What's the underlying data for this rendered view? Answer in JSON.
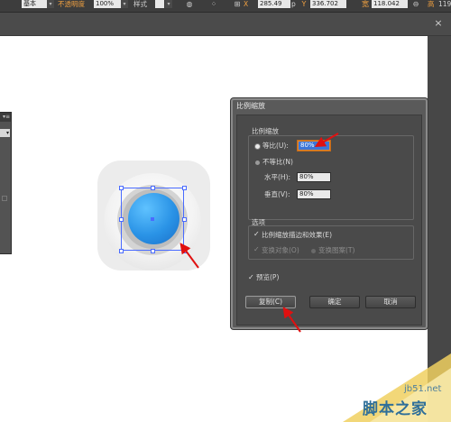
{
  "control_bar": {
    "style_value": "基本",
    "opacity_label": "不透明度",
    "opacity_value": "100%",
    "style_label": "样式",
    "x_value": "285.49",
    "x_unit": "p",
    "y_value": "336.702",
    "w_value": "118.042",
    "h_value": "119"
  },
  "dialog": {
    "title": "比例缩放",
    "scale_group_label": "比例缩放",
    "uniform_label": "等比(U):",
    "uniform_value": "80%",
    "nonuniform_label": "不等比(N)",
    "horizontal_label": "水平(H):",
    "horizontal_value": "80%",
    "vertical_label": "垂直(V):",
    "vertical_value": "80%",
    "options_label": "选项",
    "scale_strokes_label": "比例缩放描边和效果(E)",
    "transform_objects_label": "变换对象(O)",
    "transform_patterns_label": "变换图案(T)",
    "preview_label": "预览(P)",
    "copy_button": "复制(C)",
    "ok_button": "确定",
    "cancel_button": "取消"
  },
  "watermark": {
    "url": "jb51.net",
    "text": "脚本之家"
  },
  "colors": {
    "annotation_arrow": "#e01010",
    "selection": "#4a6bff",
    "ball_blue": "#2a93e6"
  }
}
